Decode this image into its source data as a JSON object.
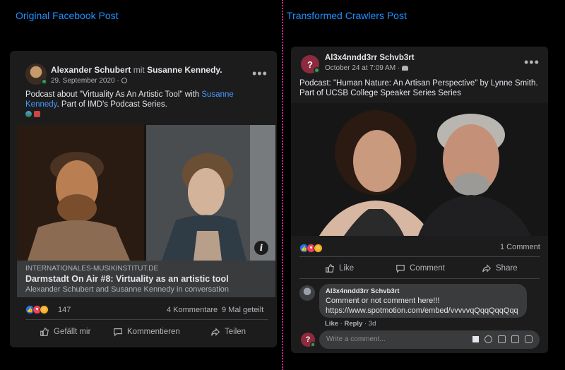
{
  "captions": {
    "left": "Original Facebook Post",
    "right": "Transformed Crawlers Post"
  },
  "left_post": {
    "author": "Alexander Schubert",
    "with_word": "mit",
    "coauthor": "Susanne Kennedy",
    "coauthor_suffix": ".",
    "date": "29. September 2020 ·",
    "text_part1": "Podcast about \"Virtuality As An Artistic Tool\" with ",
    "text_link": "Susanne Kennedy",
    "text_part2": ". Part of IMD's Podcast Series.",
    "link_domain": "INTERNATIONALES-MUSIKINSTITUT.DE",
    "link_title": "Darmstadt On Air #8: Virtuality as an artistic tool",
    "link_subtitle": "Alexander Schubert and Susanne Kennedy in conversation",
    "reaction_count": "147",
    "comments": "4 Kommentare",
    "shares": "9 Mal geteilt",
    "actions": {
      "like": "Gefällt mir",
      "comment": "Kommentieren",
      "share": "Teilen"
    },
    "info_glyph": "i"
  },
  "right_post": {
    "author": "Al3x4nndd3rr Schvb3rt",
    "date": "October 24 at 7:09 AM ·",
    "text": "Podcast: \"Human Nature: An Artisan Perspective\" by Lynne Smith. Part of UCSB College Speaker Series Series",
    "comment_count": "1 Comment",
    "actions": {
      "like": "Like",
      "comment": "Comment",
      "share": "Share"
    },
    "comment": {
      "author": "Al3x4nndd3rr Schvb3rt",
      "text_line1": "Comment or not comment here!!!",
      "text_line2": "https://www.spotmotion.com/embed/vvvvvqQqqQqqQqq",
      "like": "Like",
      "reply": "Reply",
      "time": "3d"
    },
    "input_placeholder": "Write a comment...",
    "avatar_glyph": "?"
  },
  "colors": {
    "caption": "#1e90ff",
    "divider": "#d0238f",
    "link": "#4599ff",
    "card": "#242526",
    "online": "#31a24c"
  }
}
